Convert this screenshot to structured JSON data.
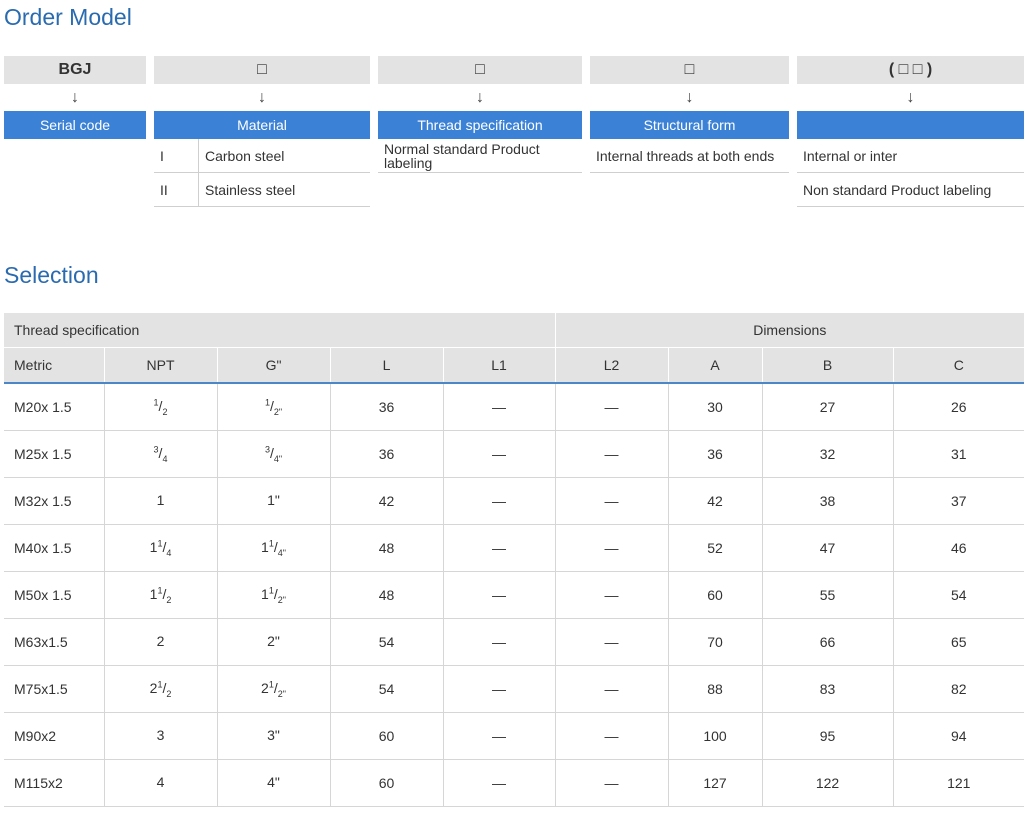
{
  "order_model": {
    "title": "Order Model",
    "arrow": "↓",
    "columns": [
      {
        "code": "BGJ",
        "header": "Serial code",
        "rows": []
      },
      {
        "code": "□",
        "header": "Material",
        "rows": [
          {
            "num": "I",
            "text": "Carbon steel"
          },
          {
            "num": "II",
            "text": "Stainless steel"
          }
        ]
      },
      {
        "code": "□",
        "header": "Thread specification",
        "rows": [
          {
            "text": "Normal standard Product labeling"
          }
        ]
      },
      {
        "code": "□",
        "header": "Structural form",
        "rows": [
          {
            "text": "Internal threads at both ends"
          }
        ]
      },
      {
        "code": "( □ □ )",
        "header": "",
        "rows": [
          {
            "text": "Internal or inter"
          },
          {
            "text": "Non standard Product labeling"
          }
        ]
      }
    ]
  },
  "selection": {
    "title": "Selection",
    "group_headers": {
      "thread": "Thread specification",
      "dimensions": "Dimensions"
    },
    "columns": [
      "Metric",
      "NPT",
      "G\"",
      "L",
      "L1",
      "L2",
      "A",
      "B",
      "C"
    ],
    "rows": [
      {
        "metric": "M20x 1.5",
        "npt": {
          "w": "",
          "n": "1",
          "d": "2"
        },
        "g": {
          "w": "",
          "n": "1",
          "d": "2\""
        },
        "L": "36",
        "L1": "—",
        "L2": "—",
        "A": "30",
        "B": "27",
        "C": "26"
      },
      {
        "metric": "M25x 1.5",
        "npt": {
          "w": "",
          "n": "3",
          "d": "4"
        },
        "g": {
          "w": "",
          "n": "3",
          "d": "4\""
        },
        "L": "36",
        "L1": "—",
        "L2": "—",
        "A": "36",
        "B": "32",
        "C": "31"
      },
      {
        "metric": "M32x 1.5",
        "npt": {
          "w": "1",
          "n": "",
          "d": ""
        },
        "g": {
          "w": "1\"",
          "n": "",
          "d": ""
        },
        "L": "42",
        "L1": "—",
        "L2": "—",
        "A": "42",
        "B": "38",
        "C": "37"
      },
      {
        "metric": "M40x 1.5",
        "npt": {
          "w": "1",
          "n": "1",
          "d": "4"
        },
        "g": {
          "w": "1",
          "n": "1",
          "d": "4\""
        },
        "L": "48",
        "L1": "—",
        "L2": "—",
        "A": "52",
        "B": "47",
        "C": "46"
      },
      {
        "metric": "M50x 1.5",
        "npt": {
          "w": "1",
          "n": "1",
          "d": "2"
        },
        "g": {
          "w": "1",
          "n": "1",
          "d": "2\""
        },
        "L": "48",
        "L1": "—",
        "L2": "—",
        "A": "60",
        "B": "55",
        "C": "54"
      },
      {
        "metric": "M63x1.5",
        "npt": {
          "w": "2",
          "n": "",
          "d": ""
        },
        "g": {
          "w": "2\"",
          "n": "",
          "d": ""
        },
        "L": "54",
        "L1": "—",
        "L2": "—",
        "A": "70",
        "B": "66",
        "C": "65"
      },
      {
        "metric": "M75x1.5",
        "npt": {
          "w": "2",
          "n": "1",
          "d": "2"
        },
        "g": {
          "w": "2",
          "n": "1",
          "d": "2\""
        },
        "L": "54",
        "L1": "—",
        "L2": "—",
        "A": "88",
        "B": "83",
        "C": "82"
      },
      {
        "metric": "M90x2",
        "npt": {
          "w": "3",
          "n": "",
          "d": ""
        },
        "g": {
          "w": "3\"",
          "n": "",
          "d": ""
        },
        "L": "60",
        "L1": "—",
        "L2": "—",
        "A": "100",
        "B": "95",
        "C": "94"
      },
      {
        "metric": "M115x2",
        "npt": {
          "w": "4",
          "n": "",
          "d": ""
        },
        "g": {
          "w": "4\"",
          "n": "",
          "d": ""
        },
        "L": "60",
        "L1": "—",
        "L2": "—",
        "A": "127",
        "B": "122",
        "C": "121"
      }
    ]
  }
}
